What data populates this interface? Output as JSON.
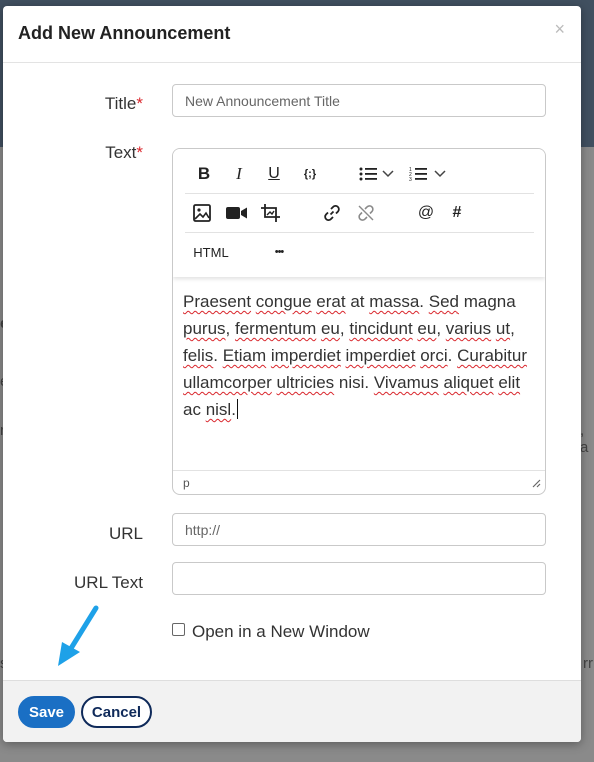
{
  "dialog": {
    "title": "Add New Announcement",
    "close_glyph": "×"
  },
  "form": {
    "title_label": "Title",
    "title_placeholder": "New Announcement Title",
    "text_label": "Text",
    "required_mark": "*",
    "url_label": "URL",
    "url_placeholder": "http://",
    "url_text_label": "URL Text",
    "open_new_window_label": "Open in a New Window",
    "open_new_window_checked": false
  },
  "editor": {
    "toolbar": {
      "bold": "B",
      "italic": "I",
      "underline": "U",
      "code": "{;}",
      "mention": "@",
      "hashtag": "#",
      "html": "HTML",
      "more": "•••"
    },
    "content": [
      {
        "t": "Praesent",
        "s": true
      },
      {
        "t": " "
      },
      {
        "t": "congue",
        "s": true
      },
      {
        "t": " "
      },
      {
        "t": "erat",
        "s": true
      },
      {
        "t": " at "
      },
      {
        "t": "massa",
        "s": true
      },
      {
        "t": ". "
      },
      {
        "t": "Sed",
        "s": true
      },
      {
        "t": " magna "
      },
      {
        "t": "purus",
        "s": true
      },
      {
        "t": ", "
      },
      {
        "t": "fermentum",
        "s": true
      },
      {
        "t": " "
      },
      {
        "t": "eu",
        "s": true
      },
      {
        "t": ", "
      },
      {
        "t": "tincidunt",
        "s": true
      },
      {
        "t": " "
      },
      {
        "t": "eu",
        "s": true
      },
      {
        "t": ", "
      },
      {
        "t": "varius",
        "s": true
      },
      {
        "t": " "
      },
      {
        "t": "ut",
        "s": true
      },
      {
        "t": ", "
      },
      {
        "t": "felis",
        "s": true
      },
      {
        "t": ". "
      },
      {
        "t": "Etiam",
        "s": true
      },
      {
        "t": " "
      },
      {
        "t": "imperdiet",
        "s": true
      },
      {
        "t": " "
      },
      {
        "t": "imperdiet",
        "s": true
      },
      {
        "t": " "
      },
      {
        "t": "orci",
        "s": true
      },
      {
        "t": ". "
      },
      {
        "t": "Curabitur",
        "s": true
      },
      {
        "t": " "
      },
      {
        "t": "ullamcorper",
        "s": true
      },
      {
        "t": " "
      },
      {
        "t": "ultricies",
        "s": true
      },
      {
        "t": " nisi. "
      },
      {
        "t": "Vivamus",
        "s": true
      },
      {
        "t": " "
      },
      {
        "t": "aliquet",
        "s": true
      },
      {
        "t": " "
      },
      {
        "t": "elit",
        "s": true
      },
      {
        "t": " ac "
      },
      {
        "t": "nisl",
        "s": true
      },
      {
        "t": "."
      }
    ],
    "status_path": "p"
  },
  "footer": {
    "save_label": "Save",
    "cancel_label": "Cancel"
  },
  "background_fragments": [
    "e",
    "e",
    "r",
    ", a",
    "rr",
    "s"
  ],
  "colors": {
    "primary": "#1a6fc4",
    "cancel_border": "#0f2a5a",
    "required": "#d9262c",
    "arrow": "#1ea1e8"
  }
}
